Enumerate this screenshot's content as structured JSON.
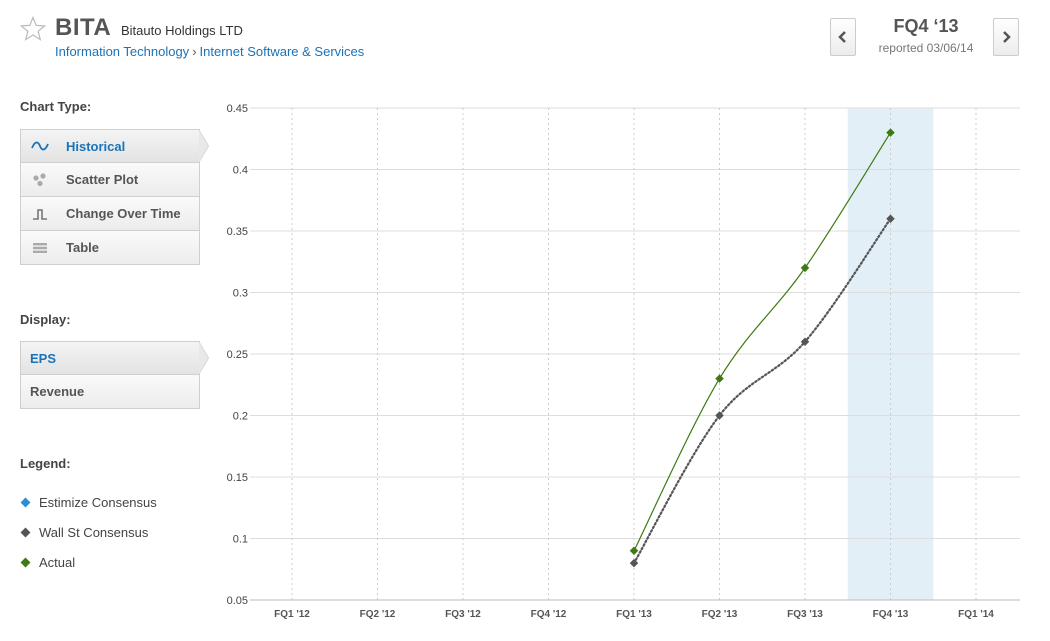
{
  "header": {
    "ticker": "BITA",
    "company": "Bitauto Holdings LTD",
    "sector": "Information Technology",
    "breadcrumb_sep": "›",
    "industry": "Internet Software & Services",
    "quarter": "FQ4 ‘13",
    "reported": "reported 03/06/14"
  },
  "chart_type": {
    "title": "Chart Type:",
    "items": [
      {
        "label": "Historical",
        "icon": "wave-icon",
        "active": true
      },
      {
        "label": "Scatter Plot",
        "icon": "scatter-dots-icon",
        "active": false
      },
      {
        "label": "Change Over Time",
        "icon": "step-icon",
        "active": false
      },
      {
        "label": "Table",
        "icon": "table-icon",
        "active": false
      }
    ]
  },
  "display": {
    "title": "Display:",
    "items": [
      {
        "label": "EPS",
        "active": true
      },
      {
        "label": "Revenue",
        "active": false
      }
    ]
  },
  "legend": {
    "title": "Legend:",
    "items": [
      {
        "label": "Estimize Consensus",
        "color": "#2b8fd6"
      },
      {
        "label": "Wall St Consensus",
        "color": "#555555"
      },
      {
        "label": "Actual",
        "color": "#3d7a12"
      }
    ]
  },
  "colors": {
    "actual": "#3d7a12",
    "wallst": "#555555",
    "highlight": "#e3eff7",
    "accent": "#1a73b8"
  },
  "chart_data": {
    "type": "line",
    "categories": [
      "FQ1 '12",
      "FQ2 '12",
      "FQ3 '12",
      "FQ4 '12",
      "FQ1 '13",
      "FQ2 '13",
      "FQ3 '13",
      "FQ4 '13",
      "FQ1 '14"
    ],
    "ylim": [
      0.05,
      0.45
    ],
    "yticks": [
      0.05,
      0.1,
      0.15,
      0.2,
      0.25,
      0.3,
      0.35,
      0.4,
      0.45
    ],
    "ytick_labels": [
      "0.05",
      "0.1",
      "0.15",
      "0.2",
      "0.25",
      "0.3",
      "0.35",
      "0.4",
      "0.45"
    ],
    "highlight_category": "FQ4 '13",
    "grid": true,
    "series": [
      {
        "name": "Actual",
        "style": "solid",
        "color": "#3d7a12",
        "values": [
          null,
          null,
          null,
          null,
          0.09,
          0.23,
          0.32,
          0.43,
          null
        ]
      },
      {
        "name": "Wall St Consensus",
        "style": "dotted",
        "color": "#555555",
        "values": [
          null,
          null,
          null,
          null,
          0.08,
          0.2,
          0.26,
          0.36,
          null
        ]
      }
    ]
  }
}
